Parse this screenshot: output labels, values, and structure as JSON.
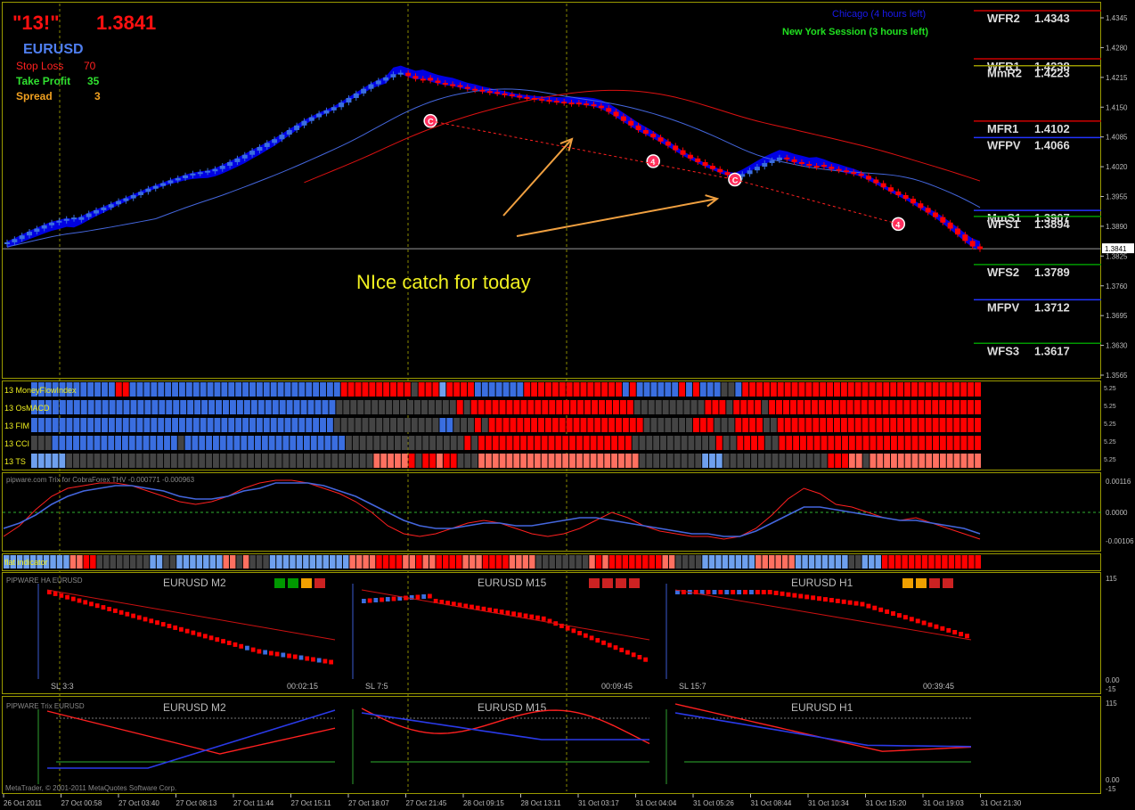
{
  "header": {
    "title": "\"13!\"",
    "price": "1.3841",
    "symbol": "EURUSD",
    "stop_loss_label": "Stop Loss",
    "stop_loss_value": "70",
    "take_profit_label": "Take Profit",
    "take_profit_value": "35",
    "spread_label": "Spread",
    "spread_value": "3"
  },
  "sessions": {
    "chicago": "Chicago (4 hours left)",
    "new_york": "New York Session (3 hours left)"
  },
  "annotation": "NIce catch for today",
  "copyright": "MetaTrader, © 2001-2011 MetaQuotes Software Corp.",
  "colors": {
    "background": "#000000",
    "frame": "#c8c800",
    "bull": "#3a6ee0",
    "bear": "#ff0000",
    "cloud": "#0000ee",
    "ma_fast": "#4466dd",
    "ma_slow": "#dd1111",
    "neutral": "#444444",
    "light_blue": "#6ea0ee",
    "salmon": "#ff7060",
    "arrow": "#f0a040",
    "price_label_bg": "#f0a000"
  },
  "chart_data": [
    {
      "type": "candlestick",
      "symbol": "EURUSD",
      "current_price": 1.3841,
      "y_ticks": [
        "1.4345",
        "1.4280",
        "1.4215",
        "1.4150",
        "1.4085",
        "1.4020",
        "1.3955",
        "1.3890",
        "1.3825",
        "1.3760",
        "1.3695",
        "1.3630",
        "1.3565"
      ],
      "ylim": [
        1.3565,
        1.4345
      ],
      "x_ticks": [
        "26 Oct 2011",
        "27 Oct 00:58",
        "27 Oct 03:40",
        "27 Oct 08:13",
        "27 Oct 11:44",
        "27 Oct 15:11",
        "27 Oct 18:07",
        "27 Oct 21:45",
        "28 Oct 09:15",
        "28 Oct 13:11",
        "31 Oct 03:17",
        "31 Oct 04:04",
        "31 Oct 05:26",
        "31 Oct 08:44",
        "31 Oct 10:34",
        "31 Oct 15:20",
        "31 Oct 19:03",
        "31 Oct 21:30"
      ],
      "pivot_levels": [
        {
          "name": "WFR2",
          "value": "1.4343",
          "color": "#cc0000"
        },
        {
          "name": "WFR1",
          "value": "1.4238",
          "color": "#cc0000"
        },
        {
          "name": "MmR2",
          "value": "1.4223",
          "color": "#999900"
        },
        {
          "name": "MFR1",
          "value": "1.4102",
          "color": "#cc0000"
        },
        {
          "name": "WFPV",
          "value": "1.4066",
          "color": "#2233ff"
        },
        {
          "name": "MmS1",
          "value": "1.3907",
          "color": "#2233ff"
        },
        {
          "name": "WFS1",
          "value": "1.3894",
          "color": "#009900"
        },
        {
          "name": "WFS2",
          "value": "1.3789",
          "color": "#009900"
        },
        {
          "name": "MFPV",
          "value": "1.3712",
          "color": "#2233ff"
        },
        {
          "name": "WFS3",
          "value": "1.3617",
          "color": "#009900"
        }
      ],
      "close_series": [
        1.3855,
        1.3862,
        1.387,
        1.3878,
        1.3885,
        1.3892,
        1.3898,
        1.3902,
        1.3906,
        1.3904,
        1.391,
        1.3918,
        1.3925,
        1.3931,
        1.3938,
        1.3945,
        1.3951,
        1.3958,
        1.3965,
        1.3972,
        1.3978,
        1.3984,
        1.399,
        1.3995,
        1.4001,
        1.4005,
        1.4008,
        1.401,
        1.4015,
        1.4022,
        1.403,
        1.4038,
        1.4046,
        1.4055,
        1.4063,
        1.4072,
        1.408,
        1.409,
        1.41,
        1.411,
        1.412,
        1.4128,
        1.4136,
        1.4143,
        1.415,
        1.416,
        1.417,
        1.418,
        1.419,
        1.42,
        1.4208,
        1.4215,
        1.4222,
        1.4225,
        1.4218,
        1.4212,
        1.4214,
        1.4208,
        1.4203,
        1.42,
        1.4198,
        1.4194,
        1.419,
        1.4188,
        1.4185,
        1.4183,
        1.418,
        1.4178,
        1.4175,
        1.4172,
        1.417,
        1.4168,
        1.4166,
        1.4164,
        1.4162,
        1.416,
        1.416,
        1.4158,
        1.4156,
        1.4153,
        1.4148,
        1.414,
        1.413,
        1.412,
        1.411,
        1.41,
        1.4092,
        1.4084,
        1.4075,
        1.4066,
        1.4056,
        1.4046,
        1.4038,
        1.403,
        1.4022,
        1.4015,
        1.4008,
        1.4002,
        1.3998,
        1.4004,
        1.4012,
        1.402,
        1.4028,
        1.4034,
        1.404,
        1.4036,
        1.403,
        1.4026,
        1.4022,
        1.4024,
        1.402,
        1.4015,
        1.4012,
        1.4008,
        1.4005,
        1.4,
        1.3992,
        1.3984,
        1.3975,
        1.3966,
        1.3958,
        1.395,
        1.394,
        1.393,
        1.392,
        1.391,
        1.3898,
        1.3885,
        1.3872,
        1.3858,
        1.3846,
        1.384
      ],
      "signal_markers": [
        {
          "label": "C",
          "price": 1.412
        },
        {
          "label": "4",
          "price": 1.4032
        },
        {
          "label": "C",
          "price": 1.3992
        },
        {
          "label": "4",
          "price": 1.3895
        }
      ]
    },
    {
      "type": "heatmap",
      "rows": [
        "13 MoneyFlowIndex",
        "13 OsMACD",
        "13 FIM",
        "13 CCI",
        "13 TS"
      ],
      "right_labels": [
        "5.25",
        "5.25",
        "5.25",
        "5.25",
        "5.25"
      ],
      "cell_codes": {
        "B": "bull",
        "L": "light_blue",
        "R": "bear",
        "S": "salmon",
        "G": "neutral"
      },
      "cells": [
        "BBBBBBBBBBBBRRBBBBBBBBBBBBBBBBBBBBBBBBBBBBBBRRRRRRRRRRGRRRLRRRRBBBBBBBRRRRRRRRRRRRRRBRBBBBBBRBRBBBGGBRRRRRRRRRRRRRRRRRRRRRRRRRRRRRRRRRR",
        "BBBBBBBBBBBBBBBBBBBBBBBBBBBBBBBBBBBBBBBBBBBGGGGGGGGGGGGGGGGGRGRRRRRRRRRRRRRRRRRRRRRRRGGGGGGGGGGRRRGRRRRGRRRRRRRRRRRRRRRRRRRRRRRRRRRRRR",
        "BBBBBBBBBBBBBBBBBBBBBBBBBBBBBBBBBBBBBBBBBBBGGGGGGGGGGGGGGGBBGGGRGRRRRRRRRRRRRRRRRRRRRRRGGGGGGGRRRGGGRRRRGGRRRRRRRRRRRRRRRRRRRRRRRRRRRRR",
        "GGGBBBBBBBBBBBBBBBBBBGBBBBBBBBBBBBBBBBBBBBBBBGGGGGGGGGGGGGGGGGRGRRRRRRRRRRRRRRRRRRRRRRGGGGGGGGGGGGRGGRRRRGGRRRRRRRRRRRRRRRRRRRRRRRRRRRRR",
        "LLLLLGGGGGGGGGGGGGGGGGGGGGGGGGGGGGGGGGGGGGGGGGGGGSSSSSRGRRSRRGGGSSSSSSSSSSSSSSSSSSSSSSSGGGGGGGGGLLLGGGGGGGGGGGGGGGRRRSSGSSSSSSSSSSSSSSSS"
      ]
    },
    {
      "type": "line",
      "title": "pipware.com Trix for CobraForex THV -0.000771 -0.000963",
      "y_ticks": [
        "0.00116",
        "0.0000",
        "-0.00106"
      ],
      "series": [
        {
          "values": [
            -0.0009,
            -0.0005,
            0.0001,
            0.0006,
            0.0009,
            0.001,
            0.0011,
            0.0011,
            0.001,
            0.0008,
            0.0006,
            0.0004,
            0.0003,
            0.0004,
            0.0006,
            0.0009,
            0.0011,
            0.0012,
            0.0012,
            0.0011,
            0.0009,
            0.0007,
            0.0004,
            0.0,
            -0.0005,
            -0.0008,
            -0.0009,
            -0.0008,
            -0.0006,
            -0.0004,
            -0.0003,
            -0.0004,
            -0.0006,
            -0.0008,
            -0.0009,
            -0.0008,
            -0.0006,
            -0.0003,
            0.0,
            -0.0002,
            -0.0005,
            -0.0007,
            -0.0008,
            -0.0009,
            -0.0009,
            -0.001,
            -0.0009,
            -0.0006,
            -0.0001,
            0.0005,
            0.0009,
            0.0007,
            0.0003,
            0.0002,
            0.0,
            -0.0002,
            -0.0003,
            -0.0002,
            -0.0004,
            -0.0006,
            -0.0008,
            -0.001
          ]
        },
        {
          "values": [
            -0.0006,
            -0.0004,
            -0.0001,
            0.0003,
            0.0006,
            0.0008,
            0.0009,
            0.001,
            0.001,
            0.0009,
            0.0008,
            0.0006,
            0.0005,
            0.0005,
            0.0006,
            0.0008,
            0.0009,
            0.0011,
            0.0011,
            0.0011,
            0.001,
            0.0008,
            0.0006,
            0.0003,
            0.0,
            -0.0003,
            -0.0005,
            -0.0006,
            -0.0006,
            -0.0005,
            -0.0004,
            -0.0004,
            -0.0005,
            -0.0005,
            -0.0004,
            -0.0003,
            -0.0002,
            -0.0002,
            -0.0003,
            -0.0004,
            -0.0005,
            -0.0006,
            -0.0007,
            -0.0008,
            -0.0008,
            -0.0009,
            -0.0009,
            -0.0007,
            -0.0004,
            -0.0001,
            0.0002,
            0.0002,
            0.0001,
            0.0,
            -0.0001,
            -0.0002,
            -0.0003,
            -0.0003,
            -0.0004,
            -0.0005,
            -0.0006,
            -0.0008
          ]
        }
      ]
    },
    {
      "type": "heatmap",
      "rows": [
        "flat indicator"
      ],
      "cell_codes": {
        "B": "bull",
        "L": "light_blue",
        "R": "bear",
        "S": "salmon",
        "G": "neutral"
      },
      "cells": [
        "LLLLLLLLLLSSRRGGGGGGGGLLGGLLLLLLLSSGSGGGLLLLLLLLLLLLSSSSRRRRSSRSSRRRRSSSRRRRSSSSGGGGGGGGSRSRRRRRRRRSSGGGGLLLLLLLLSSSSSSLLLLLLLLGGLLLRRRRRRRRRRRRRRR"
      ]
    },
    {
      "type": "candlestick",
      "title": "PIPWARE HA EURUSD",
      "panels": [
        {
          "name": "EURUSD M2",
          "sl": "SL 3:3",
          "time": "00:02:15",
          "squares": [
            "#009900",
            "#009900",
            "#f0a000",
            "#cc2222"
          ]
        },
        {
          "name": "EURUSD M15",
          "sl": "SL 7:5",
          "time": "00:09:45",
          "squares": [
            "#cc2222",
            "#cc2222",
            "#cc2222",
            "#cc2222"
          ]
        },
        {
          "name": "EURUSD H1",
          "sl": "SL 15:7",
          "time": "00:39:45",
          "squares": [
            "#f0a000",
            "#f0a000",
            "#cc2222",
            "#cc2222"
          ]
        }
      ],
      "y_ticks": [
        "115",
        "0.00",
        "-15"
      ]
    },
    {
      "type": "line",
      "title": "PIPWARE Trix EURUSD",
      "panels": [
        {
          "name": "EURUSD M2"
        },
        {
          "name": "EURUSD M15"
        },
        {
          "name": "EURUSD H1"
        }
      ],
      "y_ticks": [
        "115",
        "0.00",
        "-15"
      ]
    }
  ]
}
